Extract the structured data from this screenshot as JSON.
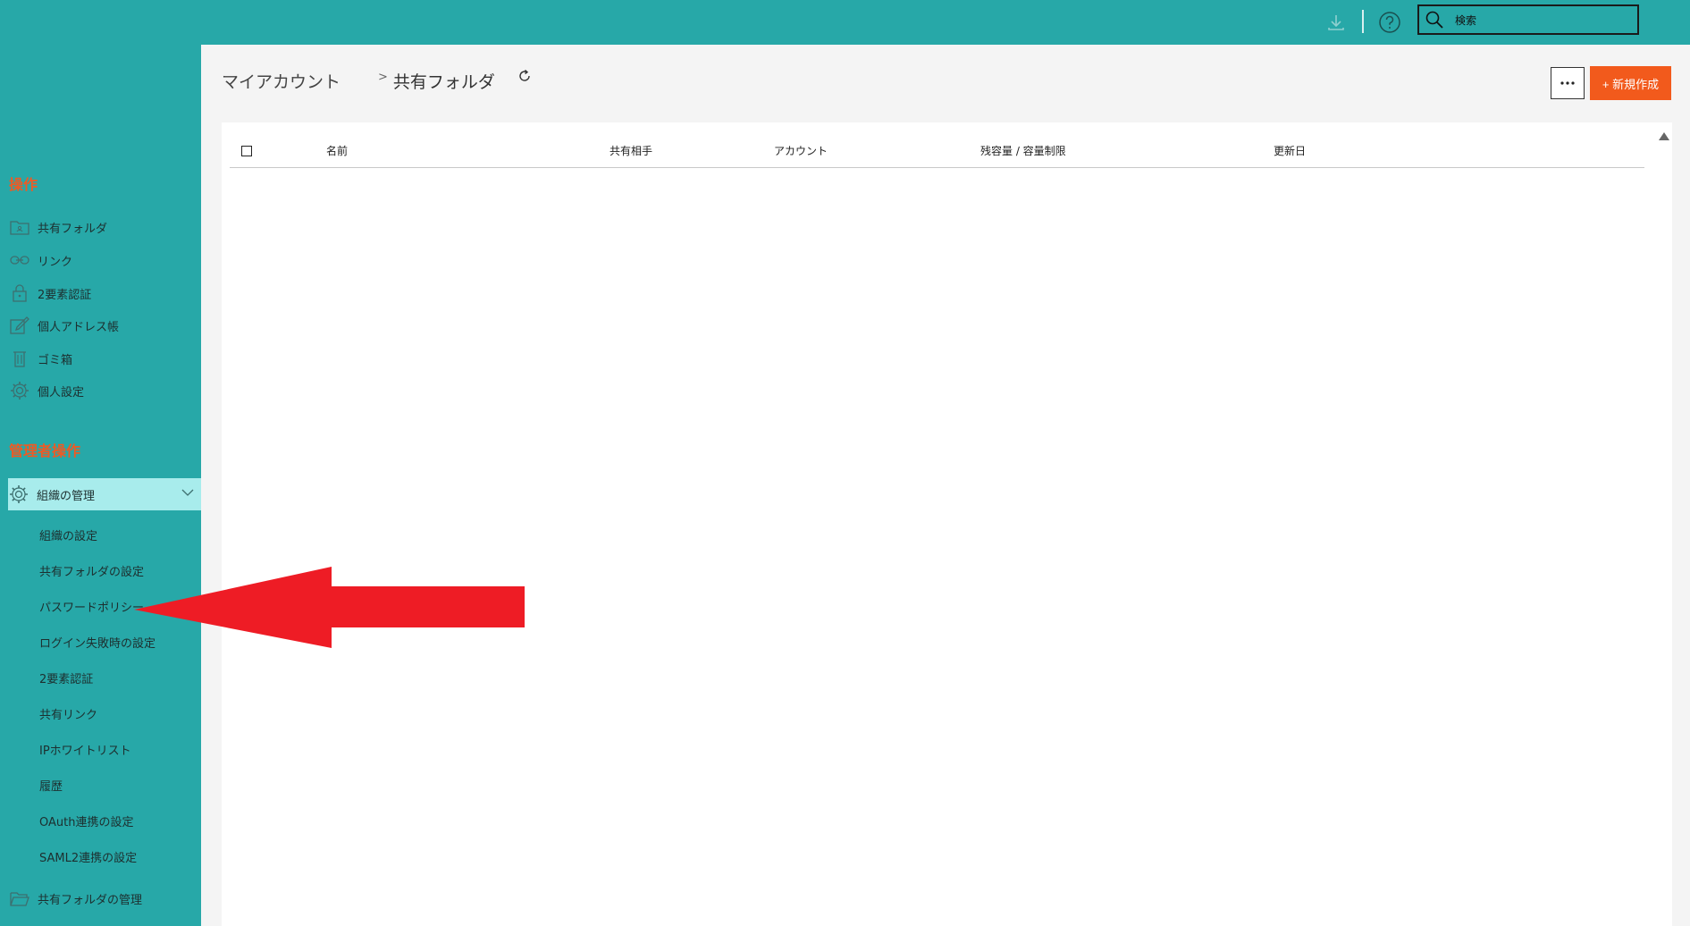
{
  "header": {
    "search_placeholder": "検索",
    "download_icon": "download-icon",
    "help_icon": "help-icon"
  },
  "sidebar": {
    "section_ops": "操作",
    "ops_items": [
      {
        "label": "共有フォルダ",
        "icon": "shared-folder-icon"
      },
      {
        "label": "リンク",
        "icon": "link-icon"
      },
      {
        "label": "2要素認証",
        "icon": "lock-icon"
      },
      {
        "label": "個人アドレス帳",
        "icon": "edit-icon"
      },
      {
        "label": "ゴミ箱",
        "icon": "trash-icon"
      },
      {
        "label": "個人設定",
        "icon": "gear-icon"
      }
    ],
    "section_admin": "管理者操作",
    "org_manage": "組織の管理",
    "org_sub_items": [
      "組織の設定",
      "共有フォルダの設定",
      "パスワードポリシー",
      "ログイン失敗時の設定",
      "2要素認証",
      "共有リンク",
      "IPホワイトリスト",
      "履歴",
      "OAuth連携の設定",
      "SAML2連携の設定"
    ],
    "shared_folder_manage": "共有フォルダの管理"
  },
  "main": {
    "breadcrumb_root": "マイアカウント",
    "breadcrumb_current": "共有フォルダ",
    "new_button": "+ 新規作成",
    "table_headers": {
      "name": "名前",
      "shared_with": "共有相手",
      "account": "アカウント",
      "capacity": "残容量 / 容量制限",
      "updated": "更新日"
    }
  },
  "colors": {
    "teal": "#27a8a8",
    "active_item": "#a8ecec",
    "accent_orange": "#f25a1c",
    "section_title": "#ee5a24",
    "arrow_red": "#ee1c25"
  }
}
